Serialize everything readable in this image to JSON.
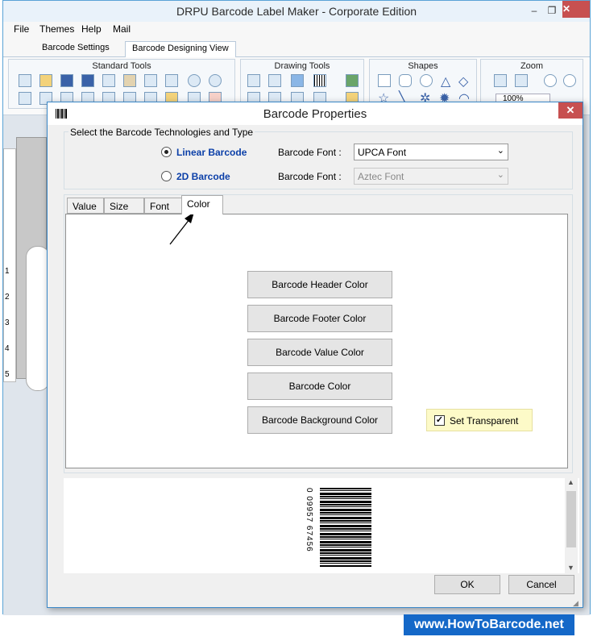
{
  "app": {
    "title": "DRPU Barcode Label Maker - Corporate Edition",
    "controls": {
      "minimize": "–",
      "maximize": "❐",
      "close": "✕"
    }
  },
  "menu": [
    "File",
    "Themes",
    "Help",
    "Mail"
  ],
  "ribbon_tabs": [
    "Barcode Settings",
    "Barcode Designing View"
  ],
  "ribbon_groups": {
    "standard_tools": "Standard Tools",
    "drawing_tools": "Drawing Tools",
    "shapes": "Shapes",
    "zoom": "Zoom"
  },
  "zoom_value": "100%",
  "ruler_numbers": [
    "1",
    "2",
    "3",
    "4",
    "5"
  ],
  "dialog": {
    "title": "Barcode Properties",
    "close": "✕",
    "tech_legend": "Select the Barcode Technologies and Type",
    "linear": {
      "label": "Linear Barcode",
      "selected": true,
      "font_label": "Barcode Font :",
      "font_value": "UPCA Font"
    },
    "twod": {
      "label": "2D Barcode",
      "selected": false,
      "font_label": "Barcode Font :",
      "font_value": "Aztec Font"
    },
    "tabs": [
      "Value",
      "Size",
      "Font",
      "Color"
    ],
    "active_tab": "Color",
    "color_buttons": [
      "Barcode Header Color",
      "Barcode Footer Color",
      "Barcode Value Color",
      "Barcode Color",
      "Barcode Background Color"
    ],
    "transparent": {
      "label": "Set Transparent",
      "checked": true
    },
    "barcode_text": "0  09957  67456",
    "ok": "OK",
    "cancel": "Cancel"
  },
  "watermark": "www.HowToBarcode.net"
}
